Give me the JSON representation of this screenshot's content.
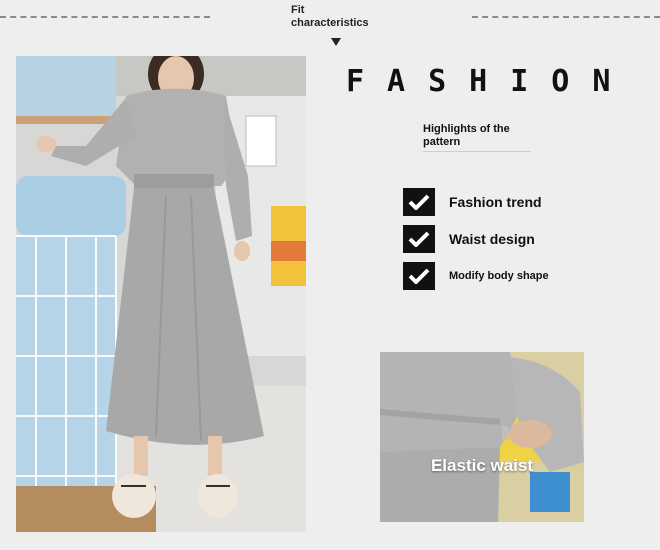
{
  "header": {
    "fit_label": "Fit characteristics"
  },
  "headline": "FASHION",
  "subheading": "Highlights of the pattern",
  "features": [
    {
      "label": "Fashion trend"
    },
    {
      "label": "Waist design"
    },
    {
      "label": "Modify body shape"
    }
  ],
  "detail_caption": "Elastic waist",
  "colors": {
    "background": "#eeeeee",
    "dress": "#a9a9a9",
    "check_box": "#111111"
  }
}
